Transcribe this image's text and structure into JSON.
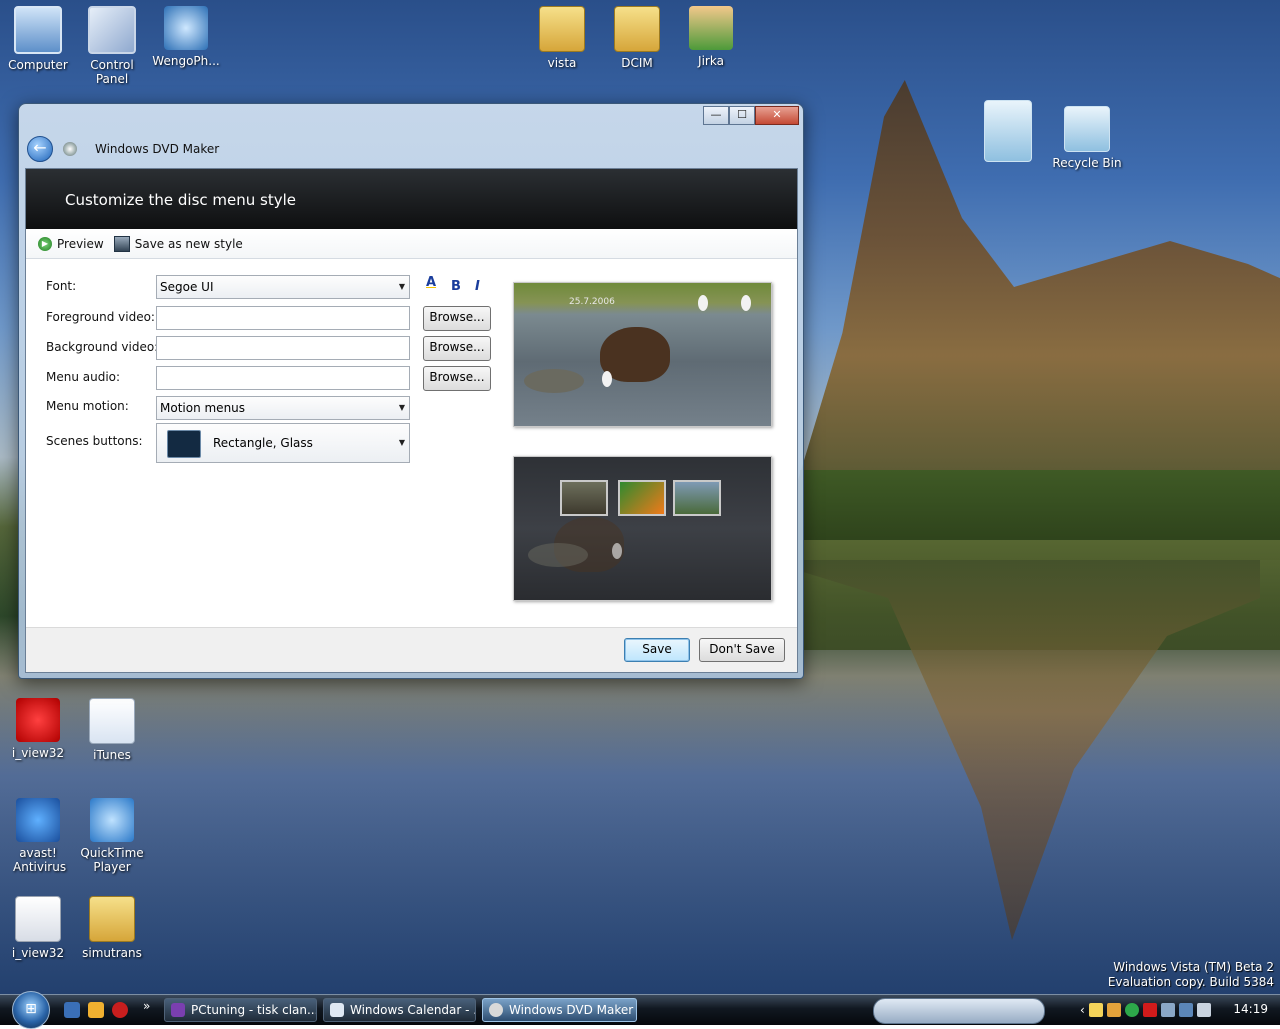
{
  "desktop": {
    "icons": [
      {
        "label": "Computer"
      },
      {
        "label": "Control Panel"
      },
      {
        "label": "WengoPh..."
      },
      {
        "label": "vista"
      },
      {
        "label": "DCIM"
      },
      {
        "label": "Jirka"
      },
      {
        "label": "Recycle Bin"
      },
      {
        "label": "i_view32"
      },
      {
        "label": "iTunes"
      },
      {
        "label": "avast! Antivirus"
      },
      {
        "label": "QuickTime Player"
      },
      {
        "label": "i_view32"
      },
      {
        "label": "simutrans"
      }
    ],
    "watermark_line1": "Windows Vista (TM) Beta 2",
    "watermark_line2": "Evaluation copy. Build 5384"
  },
  "window": {
    "title": "Windows DVD Maker",
    "controls": {
      "minimize": "—",
      "maximize": "☐",
      "close": "✕"
    },
    "header_title": "Customize the disc menu style",
    "toolbar": {
      "preview_label": "Preview",
      "save_style_label": "Save as new style"
    },
    "form": {
      "font_label": "Font:",
      "font_value": "Segoe UI",
      "foreground_label": "Foreground video:",
      "foreground_value": "",
      "background_label": "Background video:",
      "background_value": "",
      "audio_label": "Menu audio:",
      "audio_value": "",
      "motion_label": "Menu motion:",
      "motion_value": "Motion menus",
      "scenes_label": "Scenes buttons:",
      "scenes_value": "Rectangle, Glass",
      "browse_label": "Browse...",
      "format": {
        "color": "A",
        "bold": "B",
        "italic": "I"
      }
    },
    "preview": {
      "date_overlay": "25.7.2006"
    },
    "footer": {
      "save_label": "Save",
      "dont_save_label": "Don't Save"
    }
  },
  "taskbar": {
    "tasks": [
      {
        "label": "PCtuning - tisk clan..."
      },
      {
        "label": "Windows Calendar - ..."
      },
      {
        "label": "Windows DVD Maker"
      }
    ],
    "quick_launch_more": "»",
    "clock": "14:19"
  },
  "colors": {
    "header": "#0e0f10",
    "accent": "#3c7fb1",
    "taskbar": "#111821"
  }
}
